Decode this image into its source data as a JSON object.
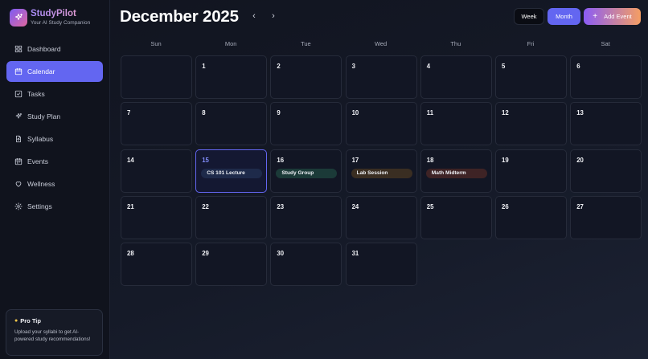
{
  "brand": {
    "name": "StudyPilot",
    "tagline": "Your AI Study Companion"
  },
  "sidebar": {
    "items": [
      {
        "label": "Dashboard",
        "icon": "dashboard-icon",
        "active": false
      },
      {
        "label": "Calendar",
        "icon": "calendar-icon",
        "active": true
      },
      {
        "label": "Tasks",
        "icon": "checkbox-icon",
        "active": false
      },
      {
        "label": "Study Plan",
        "icon": "sparkle-icon",
        "active": false
      },
      {
        "label": "Syllabus",
        "icon": "file-upload-icon",
        "active": false
      },
      {
        "label": "Events",
        "icon": "calendar-days-icon",
        "active": false
      },
      {
        "label": "Wellness",
        "icon": "heart-icon",
        "active": false
      },
      {
        "label": "Settings",
        "icon": "gear-icon",
        "active": false
      }
    ]
  },
  "protip": {
    "title": "Pro Tip",
    "body": "Upload your syllabi to get AI-powered study recommendations!"
  },
  "header": {
    "month_label": "December 2025",
    "prev_symbol": "‹",
    "next_symbol": "›",
    "week_label": "Week",
    "month_view_label": "Month",
    "add_event_label": "Add Event",
    "add_symbol": "+"
  },
  "calendar": {
    "weekdays": [
      "Sun",
      "Mon",
      "Tue",
      "Wed",
      "Thu",
      "Fri",
      "Sat"
    ],
    "start_weekday": 1,
    "days_in_month": 31,
    "today": 15,
    "events": [
      {
        "day": 15,
        "title": "CS 101 Lecture",
        "color": "#1e2a4a"
      },
      {
        "day": 16,
        "title": "Study Group",
        "color": "#1b3a38"
      },
      {
        "day": 17,
        "title": "Lab Session",
        "color": "#3a2e22"
      },
      {
        "day": 18,
        "title": "Math Midterm",
        "color": "#3e2325"
      }
    ]
  },
  "colors": {
    "accent": "#6366f1",
    "gradient_start": "#8b5cf6",
    "gradient_end": "#f59e63"
  }
}
